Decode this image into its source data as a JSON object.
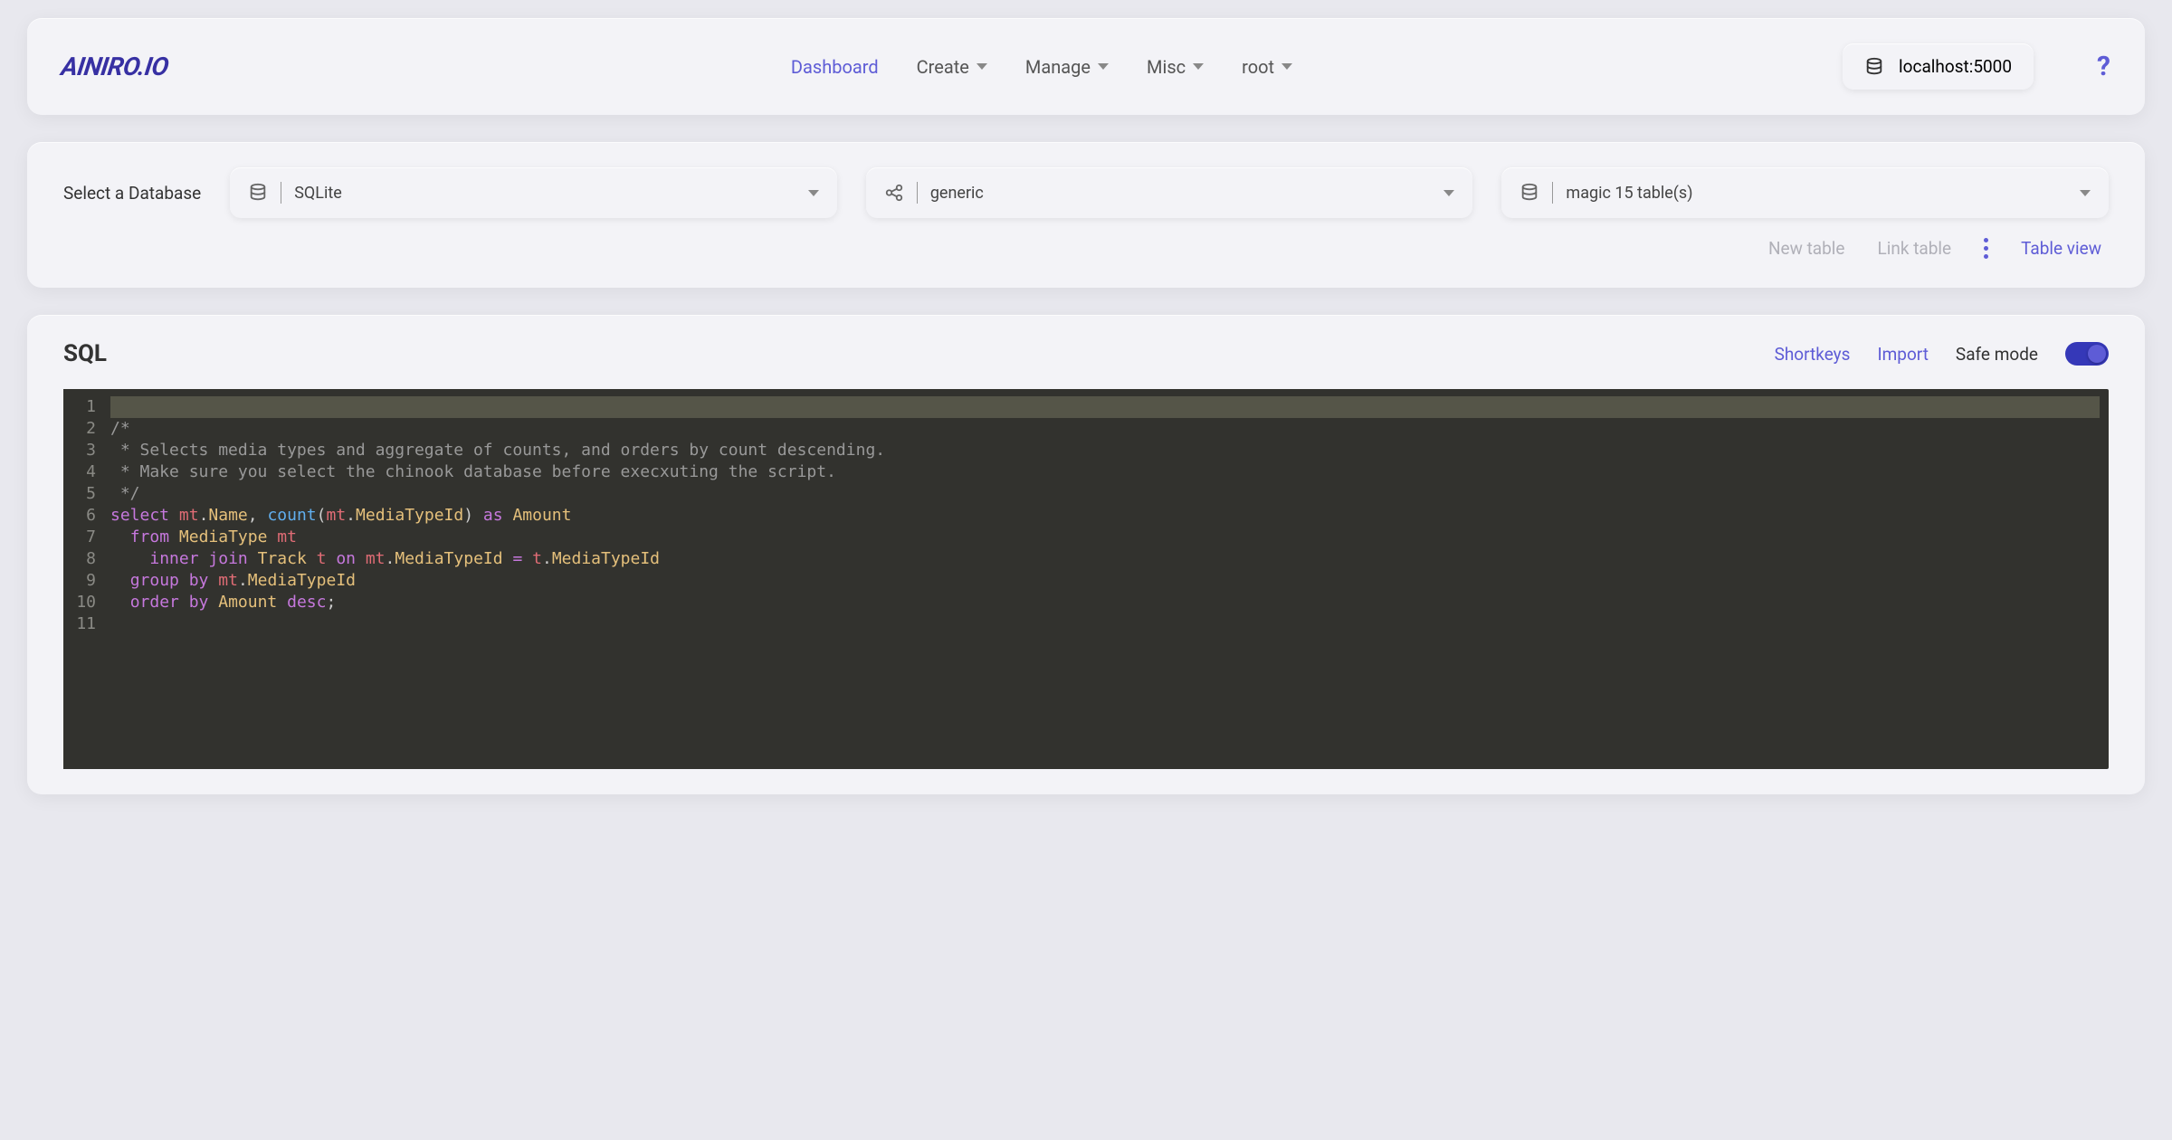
{
  "header": {
    "logo": "AINIRO.IO",
    "nav": {
      "dashboard": "Dashboard",
      "create": "Create",
      "manage": "Manage",
      "misc": "Misc",
      "root": "root"
    },
    "host": "localhost:5000",
    "help": "?"
  },
  "db": {
    "label": "Select a Database",
    "engine": "SQLite",
    "connection": "generic",
    "tables": "magic 15 table(s)",
    "actions": {
      "new_table": "New table",
      "link_table": "Link table",
      "table_view": "Table view"
    }
  },
  "sql": {
    "title": "SQL",
    "shortkeys": "Shortkeys",
    "import": "Import",
    "safe_mode": "Safe mode",
    "line_numbers": [
      "1",
      "2",
      "3",
      "4",
      "5",
      "6",
      "7",
      "8",
      "9",
      "10",
      "11"
    ],
    "code": {
      "comment_open": "/*",
      "comment_l1": " * Selects media types and aggregate of counts, and orders by count descending.",
      "comment_l2": " * Make sure you select the chinook database before execxuting the script.",
      "comment_close": " */",
      "l6": {
        "select": "select",
        "mt": "mt",
        "name": "Name",
        "count": "count",
        "mediaTypeId": "MediaTypeId",
        "as": "as",
        "amount": "Amount"
      },
      "l7": {
        "from": "from",
        "mediaType": "MediaType",
        "mt": "mt"
      },
      "l8": {
        "inner": "inner",
        "join": "join",
        "track": "Track",
        "t": "t",
        "on": "on",
        "mt": "mt",
        "mediaTypeId": "MediaTypeId",
        "eq": "=",
        "t2": "t"
      },
      "l9": {
        "group": "group",
        "by": "by",
        "mt": "mt",
        "mediaTypeId": "MediaTypeId"
      },
      "l10": {
        "order": "order",
        "by": "by",
        "amount": "Amount",
        "desc": "desc"
      }
    }
  }
}
